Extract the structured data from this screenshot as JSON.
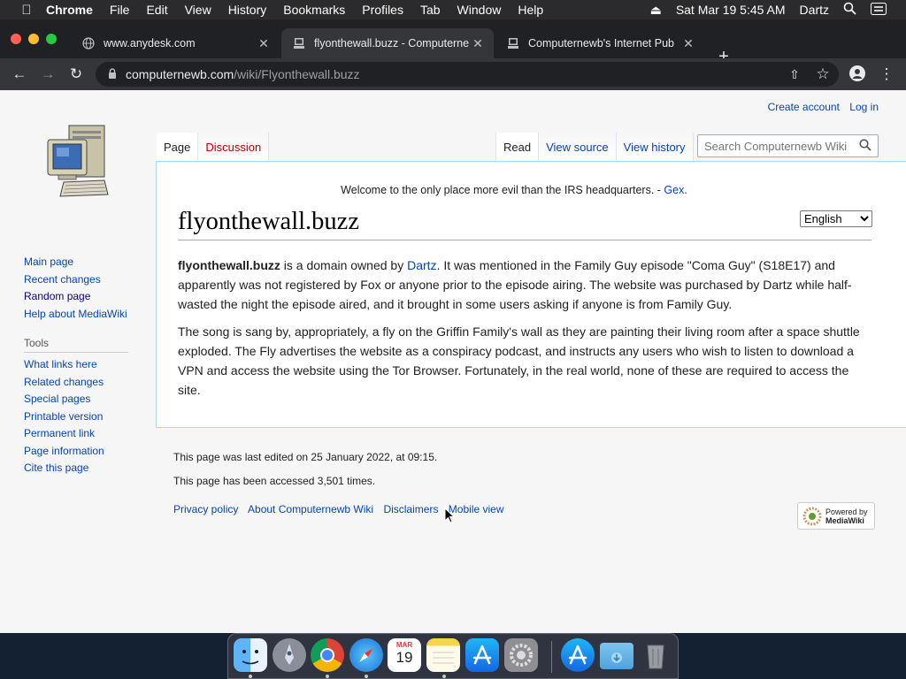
{
  "menubar": {
    "app": "Chrome",
    "items": [
      "File",
      "Edit",
      "View",
      "History",
      "Bookmarks",
      "Profiles",
      "Tab",
      "Window",
      "Help"
    ],
    "datetime": "Sat Mar 19  5:45 AM",
    "user": "Dartz"
  },
  "browser": {
    "tabs": [
      {
        "title": "www.anydesk.com",
        "favicon": "globe-icon"
      },
      {
        "title": "flyonthewall.buzz - Computernewb",
        "favicon": "computer-icon"
      },
      {
        "title": "Computernewb's Internet Pub",
        "favicon": "computer-icon"
      }
    ],
    "url_host": "computernewb.com",
    "url_path": "/wiki/Flyonthewall.buzz"
  },
  "wiki": {
    "personal": [
      "Create account",
      "Log in"
    ],
    "tabs_left": [
      "Page",
      "Discussion"
    ],
    "tabs_right": [
      "Read",
      "View source",
      "View history"
    ],
    "search_placeholder": "Search Computernewb Wiki",
    "sidebar_nav": [
      "Main page",
      "Recent changes",
      "Random page",
      "Help about MediaWiki"
    ],
    "tools_heading": "Tools",
    "tools": [
      "What links here",
      "Related changes",
      "Special pages",
      "Printable version",
      "Permanent link",
      "Page information",
      "Cite this page"
    ],
    "sitenotice": {
      "text": "Welcome to the only place more evil than the IRS headquarters. - ",
      "link": "Gex",
      "end": "."
    },
    "language": "English",
    "title": "flyonthewall.buzz",
    "para1": {
      "bold": "flyonthewall.buzz",
      "a": " is a domain owned by ",
      "link": "Dartz",
      "b": ". It was mentioned in the Family Guy episode \"Coma Guy\" (S18E17) and apparently was not registered by Fox or anyone prior to the episode airing. The website was purchased by Dartz while half-wasted the night the episode aired, and it brought in some users asking if anyone is from Family Guy."
    },
    "para2": "The song is sang by, appropriately, a fly on the Griffin Family's wall as they are painting their living room after a space shuttle exploded. The Fly advertises the website as a conspiracy podcast, and instructs any users who wish to listen to download a VPN and access the website using the Tor Browser. Fortunately, in the real world, none of these are required to access the site.",
    "footer": {
      "last_edited": "This page was last edited on 25 January 2022, at 09:15.",
      "accessed": "This page has been accessed 3,501 times.",
      "links": [
        "Privacy policy",
        "About Computernewb Wiki",
        "Disclaimers",
        "Mobile view"
      ],
      "powered_top": "Powered by",
      "powered_name": "MediaWiki"
    }
  },
  "dock": {
    "apps": [
      "finder-icon",
      "launchpad-icon",
      "chrome-icon",
      "safari-icon",
      "calendar-icon",
      "notes-icon",
      "app-store-icon",
      "system-preferences-icon",
      "app-store-icon",
      "downloads-folder-icon",
      "trash-icon"
    ],
    "calendar_month": "MAR",
    "calendar_day": "19"
  },
  "colors": {
    "link": "#0645ad",
    "redlink": "#ba0000",
    "chrome_dark": "#202124"
  }
}
